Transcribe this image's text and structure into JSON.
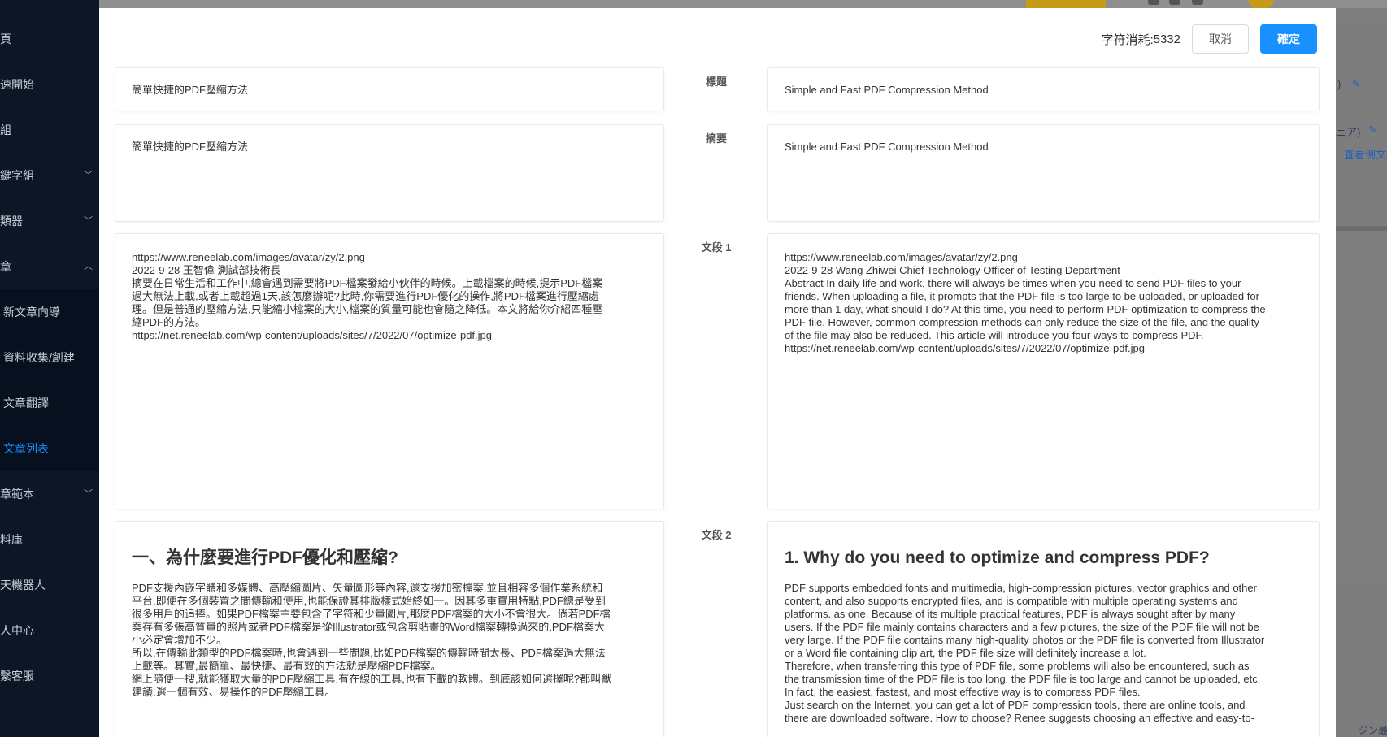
{
  "sidebar": {
    "items": [
      {
        "label": "頁",
        "chevron": false,
        "sub": false,
        "active": false
      },
      {
        "label": "速開始",
        "chevron": false,
        "sub": false,
        "active": false
      },
      {
        "label": "組",
        "chevron": false,
        "sub": false,
        "active": false
      },
      {
        "label": "鍵字組",
        "chevron": true,
        "chevron_dir": "down",
        "sub": false,
        "active": false
      },
      {
        "label": "類器",
        "chevron": true,
        "chevron_dir": "down",
        "sub": false,
        "active": false
      },
      {
        "label": "章",
        "chevron": true,
        "chevron_dir": "up",
        "sub": false,
        "active": false
      },
      {
        "label": "新文章向導",
        "chevron": false,
        "sub": true,
        "active": false
      },
      {
        "label": "資料收集/創建",
        "chevron": false,
        "sub": true,
        "active": false
      },
      {
        "label": "文章翻譯",
        "chevron": false,
        "sub": true,
        "active": false
      },
      {
        "label": "文章列表",
        "chevron": false,
        "sub": true,
        "active": true
      },
      {
        "label": "章範本",
        "chevron": true,
        "chevron_dir": "down",
        "sub": false,
        "active": false
      },
      {
        "label": "料庫",
        "chevron": false,
        "sub": false,
        "active": false
      },
      {
        "label": "天機器人",
        "chevron": false,
        "sub": false,
        "active": false
      },
      {
        "label": "人中心",
        "chevron": false,
        "sub": false,
        "active": false
      },
      {
        "label": "繫客服",
        "chevron": false,
        "sub": false,
        "active": false
      }
    ]
  },
  "background_main": {
    "edit_text_1": ")",
    "edit_text_2": "ェア)",
    "view_example_link": "查看例文",
    "bottom_text": "ジン最適"
  },
  "modal": {
    "char_cost_label": "字符消耗:",
    "char_cost_value": "5332",
    "cancel_label": "取消",
    "confirm_label": "確定",
    "rows": {
      "title": {
        "label": "標題",
        "source": "簡單快捷的PDF壓縮方法",
        "translation": "Simple and Fast PDF Compression Method"
      },
      "summary": {
        "label": "摘要",
        "source": "簡單快捷的PDF壓縮方法",
        "translation": "Simple and Fast PDF Compression Method"
      },
      "para1": {
        "label": "文段 1",
        "source_lines": [
          "https://www.reneelab.com/images/avatar/zy/2.png",
          "2022-9-28 王智偉 測試部技術長",
          "摘要在日常生活和工作中,總會遇到需要將PDF檔案發給小伙伴的時候。上載檔案的時候,提示PDF檔案",
          "過大無法上載,或者上載超過1天,該怎麼辦呢?此時,你需要進行PDF優化的操作,將PDF檔案進行壓縮處",
          "理。但是普通的壓縮方法,只能縮小檔案的大小,檔案的質量可能也會隨之降低。本文將給你介紹四種壓",
          "縮PDF的方法。",
          "https://net.reneelab.com/wp-content/uploads/sites/7/2022/07/optimize-pdf.jpg"
        ],
        "translation_lines": [
          "https://www.reneelab.com/images/avatar/zy/2.png",
          "2022-9-28 Wang Zhiwei Chief Technology Officer of Testing Department",
          "Abstract In daily life and work, there will always be times when you need to send PDF files to your",
          "friends. When uploading a file, it prompts that the PDF file is too large to be uploaded, or uploaded for",
          "more than 1 day, what should I do? At this time, you need to perform PDF optimization to compress the",
          "PDF file. However, common compression methods can only reduce the size of the file, and the quality",
          "of the file may also be reduced. This article will introduce you four ways to compress PDF.",
          "https://net.reneelab.com/wp-content/uploads/sites/7/2022/07/optimize-pdf.jpg"
        ]
      },
      "para2": {
        "label": "文段 2",
        "source_heading": "一、為什麼要進行PDF優化和壓縮?",
        "source_lines": [
          "PDF支援內嵌字體和多媒體、高壓縮圖片、矢量圖形等內容,還支援加密檔案,並且相容多個作業系統和",
          "平台,即便在多個裝置之間傳輸和使用,也能保證其排版樣式始終如一。因其多重實用特點,PDF總是受到",
          "很多用戶的追捧。如果PDF檔案主要包含了字符和少量圖片,那麼PDF檔案的大小不會很大。倘若PDF檔",
          "案存有多張高質量的照片或者PDF檔案是從Illustrator或包含剪貼畫的Word檔案轉換過來的,PDF檔案大",
          "小必定會增加不少。",
          "所以,在傳輸此類型的PDF檔案時,也會遇到一些問題,比如PDF檔案的傳輸時間太長、PDF檔案過大無法",
          "上載等。其實,最簡單、最快捷、最有效的方法就是壓縮PDF檔案。",
          "網上隨便一搜,就能獲取大量的PDF壓縮工具,有在線的工具,也有下載的軟體。到底該如何選擇呢?都叫獸",
          "建議,選一個有效、易操作的PDF壓縮工具。"
        ],
        "translation_heading": "1. Why do you need to optimize and compress PDF?",
        "translation_lines": [
          "PDF supports embedded fonts and multimedia, high-compression pictures, vector graphics and other",
          "content, and also supports encrypted files, and is compatible with multiple operating systems and",
          "platforms. as one. Because of its multiple practical features, PDF is always sought after by many",
          "users. If the PDF file mainly contains characters and a few pictures, the size of the PDF file will not be",
          "very large. If the PDF file contains many high-quality photos or the PDF file is converted from Illustrator",
          "or a Word file containing clip art, the PDF file size will definitely increase a lot.",
          "Therefore, when transferring this type of PDF file, some problems will also be encountered, such as",
          "the transmission time of the PDF file is too long, the PDF file is too large and cannot be uploaded, etc.",
          "In fact, the easiest, fastest, and most effective way is to compress PDF files.",
          "Just search on the Internet, you can get a lot of PDF compression tools, there are online tools, and",
          "there are downloaded software. How to choose? Renee suggests choosing an effective and easy-to-"
        ]
      }
    }
  },
  "colors": {
    "primary": "#1890ff",
    "sidebar_bg": "#0c1627",
    "sidebar_active": "#1890ff",
    "accent_yellow": "#c79a17"
  }
}
